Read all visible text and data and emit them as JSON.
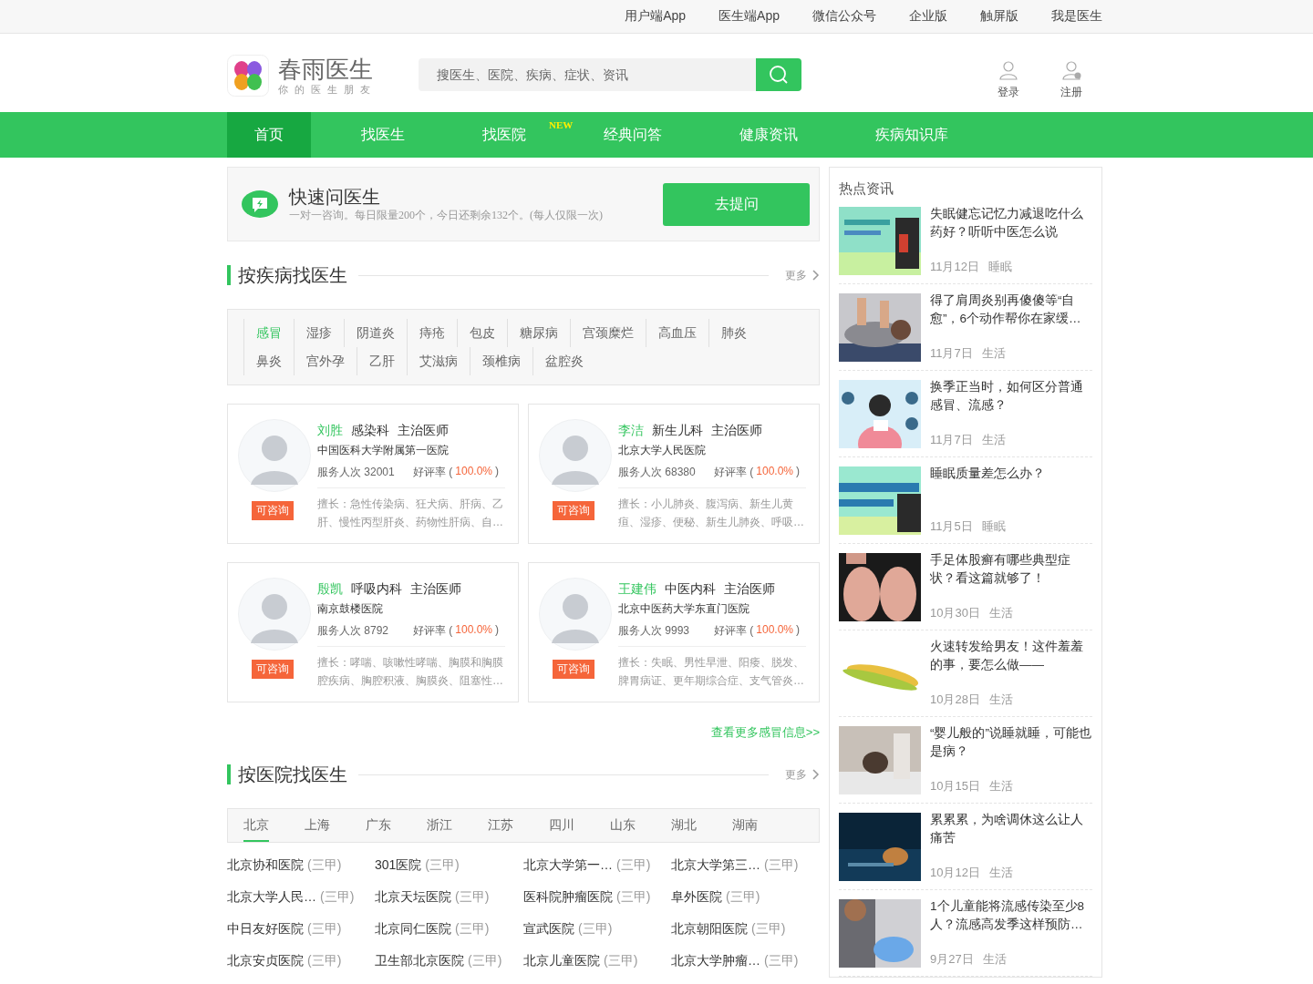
{
  "top_links": [
    "用户端App",
    "医生端App",
    "微信公众号",
    "企业版",
    "触屏版",
    "我是医生"
  ],
  "logo": {
    "name": "春雨医生",
    "tagline": "你的医生朋友"
  },
  "search": {
    "placeholder": "搜医生、医院、疾病、症状、资讯"
  },
  "account": [
    {
      "label": "登录",
      "kind": "login"
    },
    {
      "label": "注册",
      "kind": "register"
    }
  ],
  "nav": [
    {
      "label": "首页",
      "selected": true
    },
    {
      "label": "找医生",
      "selected": false
    },
    {
      "label": "找医院",
      "selected": false,
      "badge": "NEW"
    },
    {
      "label": "经典问答",
      "selected": false
    },
    {
      "label": "健康资讯",
      "selected": false
    },
    {
      "label": "疾病知识库",
      "selected": false
    }
  ],
  "quick_ask": {
    "title": "快速问医生",
    "subtitle": "一对一咨询。每日限量200个，今日还剩余132个。(每人仅限一次)",
    "button": "去提问"
  },
  "disease_section": {
    "title": "按疾病找医生",
    "more": "更多",
    "tags": [
      {
        "label": "感冒",
        "selected": true
      },
      {
        "label": "湿疹",
        "selected": false
      },
      {
        "label": "阴道炎",
        "selected": false
      },
      {
        "label": "痔疮",
        "selected": false
      },
      {
        "label": "包皮",
        "selected": false
      },
      {
        "label": "糖尿病",
        "selected": false
      },
      {
        "label": "宫颈糜烂",
        "selected": false
      },
      {
        "label": "高血压",
        "selected": false
      },
      {
        "label": "肺炎",
        "selected": false
      },
      {
        "label": "鼻炎",
        "selected": false
      },
      {
        "label": "宫外孕",
        "selected": false
      },
      {
        "label": "乙肝",
        "selected": false
      },
      {
        "label": "艾滋病",
        "selected": false
      },
      {
        "label": "颈椎病",
        "selected": false
      },
      {
        "label": "盆腔炎",
        "selected": false
      }
    ],
    "doctors": [
      {
        "name": "刘胜",
        "dept": "感染科",
        "title": "主治医师",
        "hospital": "中国医科大学附属第一医院",
        "service": "服务人次 32001",
        "rating_label": "好评率 (",
        "rating": "100.0%",
        "rating_end": ")",
        "status": "可咨询",
        "specialty": "擅长：急性传染病、狂犬病、肝病、乙肝、慢性丙型肝炎、药物性肝病、自…"
      },
      {
        "name": "李洁",
        "dept": "新生儿科",
        "title": "主治医师",
        "hospital": "北京大学人民医院",
        "service": "服务人次 68380",
        "rating_label": "好评率 (",
        "rating": "100.0%",
        "rating_end": ")",
        "status": "可咨询",
        "specialty": "擅长：小儿肺炎、腹泻病、新生儿黄疸、湿疹、便秘、新生儿肺炎、呼吸…"
      },
      {
        "name": "殷凯",
        "dept": "呼吸内科",
        "title": "主治医师",
        "hospital": "南京鼓楼医院",
        "service": "服务人次 8792",
        "rating_label": "好评率 (",
        "rating": "100.0%",
        "rating_end": ")",
        "status": "可咨询",
        "specialty": "擅长：哮喘、咳嗽性哮喘、胸膜和胸膜腔疾病、胸腔积液、胸膜炎、阻塞性…"
      },
      {
        "name": "王建伟",
        "dept": "中医内科",
        "title": "主治医师",
        "hospital": "北京中医药大学东直门医院",
        "service": "服务人次 9993",
        "rating_label": "好评率 (",
        "rating": "100.0%",
        "rating_end": ")",
        "status": "可咨询",
        "specialty": "擅长：失眠、男性早泄、阳痿、脱发、脾胃病证、更年期综合症、支气管炎…"
      }
    ],
    "more_link": "查看更多感冒信息>>"
  },
  "hospital_section": {
    "title": "按医院找医生",
    "more": "更多",
    "tabs": [
      {
        "label": "北京",
        "selected": true
      },
      {
        "label": "上海",
        "selected": false
      },
      {
        "label": "广东",
        "selected": false
      },
      {
        "label": "浙江",
        "selected": false
      },
      {
        "label": "江苏",
        "selected": false
      },
      {
        "label": "四川",
        "selected": false
      },
      {
        "label": "山东",
        "selected": false
      },
      {
        "label": "湖北",
        "selected": false
      },
      {
        "label": "湖南",
        "selected": false
      }
    ],
    "hospitals": [
      {
        "name": "北京协和医院",
        "level": "(三甲)"
      },
      {
        "name": "301医院",
        "level": "(三甲)"
      },
      {
        "name": "北京大学第一…",
        "level": "(三甲)"
      },
      {
        "name": "北京大学第三…",
        "level": "(三甲)"
      },
      {
        "name": "北京大学人民…",
        "level": "(三甲)"
      },
      {
        "name": "北京天坛医院",
        "level": "(三甲)"
      },
      {
        "name": "医科院肿瘤医院",
        "level": "(三甲)"
      },
      {
        "name": "阜外医院",
        "level": "(三甲)"
      },
      {
        "name": "中日友好医院",
        "level": "(三甲)"
      },
      {
        "name": "北京同仁医院",
        "level": "(三甲)"
      },
      {
        "name": "宣武医院",
        "level": "(三甲)"
      },
      {
        "name": "北京朝阳医院",
        "level": "(三甲)"
      },
      {
        "name": "北京安贞医院",
        "level": "(三甲)"
      },
      {
        "name": "卫生部北京医院",
        "level": "(三甲)"
      },
      {
        "name": "北京儿童医院",
        "level": "(三甲)"
      },
      {
        "name": "北京大学肿瘤…",
        "level": "(三甲)"
      }
    ]
  },
  "hot_news": {
    "title": "热点资讯",
    "items": [
      {
        "title": "失眠健忘记忆力减退吃什么药好？听听中医怎么说",
        "date": "11月12日",
        "category": "睡眠"
      },
      {
        "title": "得了肩周炎别再傻傻等“自愈”，6个动作帮你在家缓…",
        "date": "11月7日",
        "category": "生活"
      },
      {
        "title": "换季正当时，如何区分普通感冒、流感？",
        "date": "11月7日",
        "category": "生活"
      },
      {
        "title": "睡眠质量差怎么办？",
        "date": "11月5日",
        "category": "睡眠"
      },
      {
        "title": "手足体股癣有哪些典型症状？看这篇就够了！",
        "date": "10月30日",
        "category": "生活"
      },
      {
        "title": "火速转发给男友！这件羞羞的事，要怎么做——",
        "date": "10月28日",
        "category": "生活"
      },
      {
        "title": "“婴儿般的”说睡就睡，可能也是病？",
        "date": "10月15日",
        "category": "生活"
      },
      {
        "title": "累累累，为啥调休这么让人痛苦",
        "date": "10月12日",
        "category": "生活"
      },
      {
        "title": "1个儿童能将流感传染至少8人？流感高发季这样预防…",
        "date": "9月27日",
        "category": "生活"
      }
    ]
  }
}
